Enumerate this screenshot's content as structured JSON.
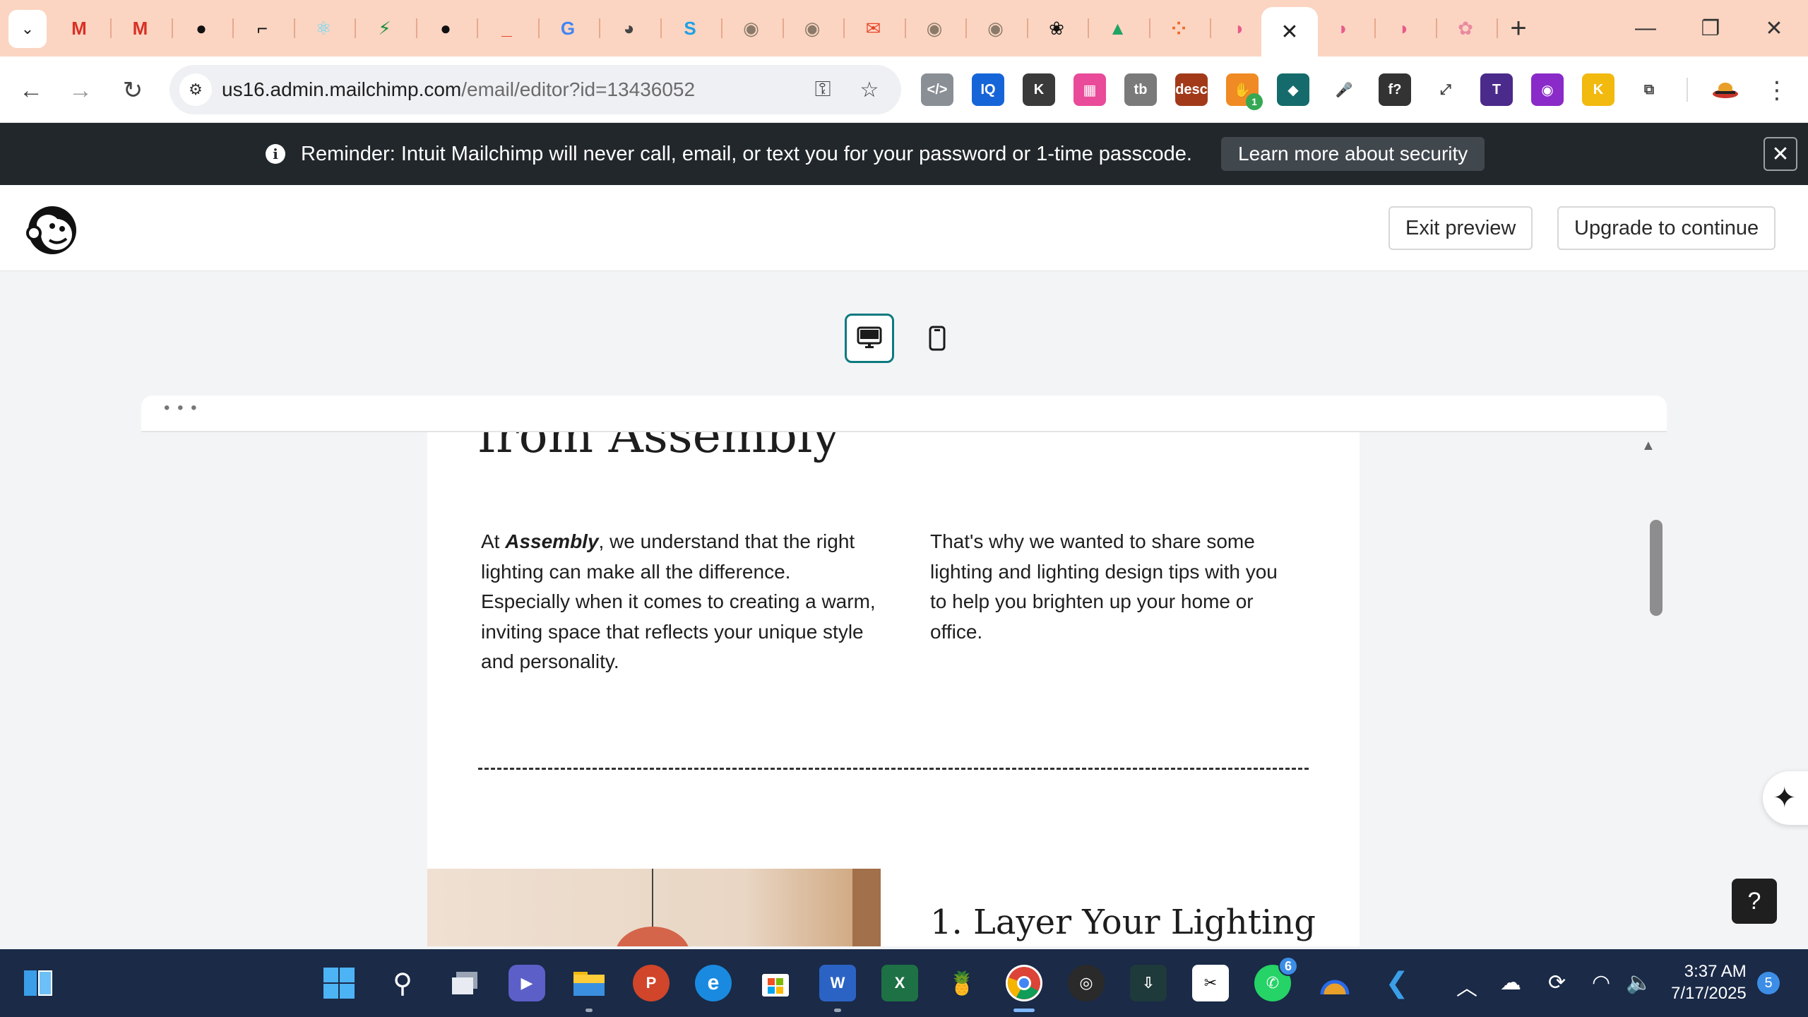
{
  "browser": {
    "address_bar": {
      "host": "us16.admin.mailchimp.com",
      "path": "/email/editor?id=13436052"
    },
    "active_tab": {
      "close_label": "✕"
    },
    "tabs": [
      {
        "icon": "gmail-icon",
        "glyph": "M",
        "color": "#d93025"
      },
      {
        "icon": "gmail-icon",
        "glyph": "M",
        "color": "#d93025"
      },
      {
        "icon": "github-icon",
        "glyph": "●",
        "color": "#111111"
      },
      {
        "icon": "app-icon",
        "glyph": "⌐",
        "color": "#111111"
      },
      {
        "icon": "react-icon",
        "glyph": "⚛",
        "color": "#61dafb"
      },
      {
        "icon": "bolt-icon",
        "glyph": "⚡",
        "color": "#1a8f3c"
      },
      {
        "icon": "github-icon",
        "glyph": "●",
        "color": "#111111"
      },
      {
        "icon": "red-app-icon",
        "glyph": "_",
        "color": "#e8452a"
      },
      {
        "icon": "google-icon",
        "glyph": "G",
        "color": "#4285f4"
      },
      {
        "icon": "globe-icon",
        "glyph": "◕",
        "color": "#444444"
      },
      {
        "icon": "s-app-icon",
        "glyph": "S",
        "color": "#1ea0e6"
      },
      {
        "icon": "avatar-tab-icon",
        "glyph": "◉",
        "color": "#8a7a6a"
      },
      {
        "icon": "avatar-tab-icon",
        "glyph": "◉",
        "color": "#8a7a6a"
      },
      {
        "icon": "mail-icon",
        "glyph": "✉",
        "color": "#e8452a"
      },
      {
        "icon": "avatar-tab-icon",
        "glyph": "◉",
        "color": "#8a7a6a"
      },
      {
        "icon": "avatar-tab-icon",
        "glyph": "◉",
        "color": "#8a7a6a"
      },
      {
        "icon": "openai-icon",
        "glyph": "❀",
        "color": "#111111"
      },
      {
        "icon": "drive-icon",
        "glyph": "▲",
        "color": "#1fa463"
      },
      {
        "icon": "tasks-icon",
        "glyph": "⁘",
        "color": "#ef6a2b"
      },
      {
        "icon": "gradient-app-icon",
        "glyph": "◗",
        "color": "#e85a8a"
      }
    ],
    "tabs_after_active": [
      {
        "icon": "gradient-app-icon",
        "glyph": "◗",
        "color": "#e85a8a"
      },
      {
        "icon": "gradient-app-icon",
        "glyph": "◗",
        "color": "#e85a8a"
      },
      {
        "icon": "brain-icon",
        "glyph": "✿",
        "color": "#e98aa0"
      }
    ],
    "extensions": [
      {
        "icon": "code-ext-icon",
        "glyph": "</>",
        "bg": "#8a8f96"
      },
      {
        "icon": "iq-ext-icon",
        "glyph": "IQ",
        "bg": "#1665d8"
      },
      {
        "icon": "k-ext-icon",
        "glyph": "K",
        "bg": "#3a3a3a"
      },
      {
        "icon": "colorgrid-ext-icon",
        "glyph": "▦",
        "bg": "#e94a9a"
      },
      {
        "icon": "tb-ext-icon",
        "glyph": "tb",
        "bg": "#7a7a7a"
      },
      {
        "icon": "desc-ext-icon",
        "glyph": "desc",
        "bg": "#a23a1a"
      },
      {
        "icon": "hand-ext-icon",
        "glyph": "✋",
        "bg": "#f08a24"
      },
      {
        "icon": "diamond-ext-icon",
        "glyph": "◆",
        "bg": "#156b6b"
      },
      {
        "icon": "mic-ext-icon",
        "glyph": "🎤",
        "bg": "#ffffff"
      },
      {
        "icon": "function-ext-icon",
        "glyph": "f?",
        "bg": "#333333"
      },
      {
        "icon": "expand-ext-icon",
        "glyph": "⤢",
        "bg": "#ffffff"
      },
      {
        "icon": "t-ext-icon",
        "glyph": "T",
        "bg": "#4a2a8a"
      },
      {
        "icon": "eye-ext-icon",
        "glyph": "◉",
        "bg": "#8a2ac8"
      },
      {
        "icon": "k-yellow-ext-icon",
        "glyph": "K",
        "bg": "#f2b90f"
      },
      {
        "icon": "puzzle-ext-icon",
        "glyph": "⧉",
        "bg": "#ffffff"
      }
    ],
    "hand_ext_badge": "1"
  },
  "banner": {
    "text": "Reminder: Intuit Mailchimp will never call, email, or text you for your password or 1-time passcode.",
    "button": "Learn more about security",
    "close": "✕",
    "info": "i"
  },
  "header": {
    "exit_preview": "Exit preview",
    "upgrade": "Upgrade to continue"
  },
  "preview": {
    "dots": "• • •",
    "email": {
      "title_fragment": "from Assembly",
      "col1_brand": "Assembly",
      "col1_pre": "At ",
      "col1_post": ", we understand that the right lighting can make all the difference. Especially when it comes to creating a warm, inviting space that reflects your unique style and personality.",
      "col2": "That's why we wanted to share some lighting and lighting design tips with you to help you brighten up your home or office.",
      "section_heading": "1. Layer Your Lighting"
    },
    "help": "?"
  },
  "taskbar": {
    "whatsapp_badge": "6",
    "time": "3:37 AM",
    "date": "7/17/2025",
    "notifications": "5"
  }
}
